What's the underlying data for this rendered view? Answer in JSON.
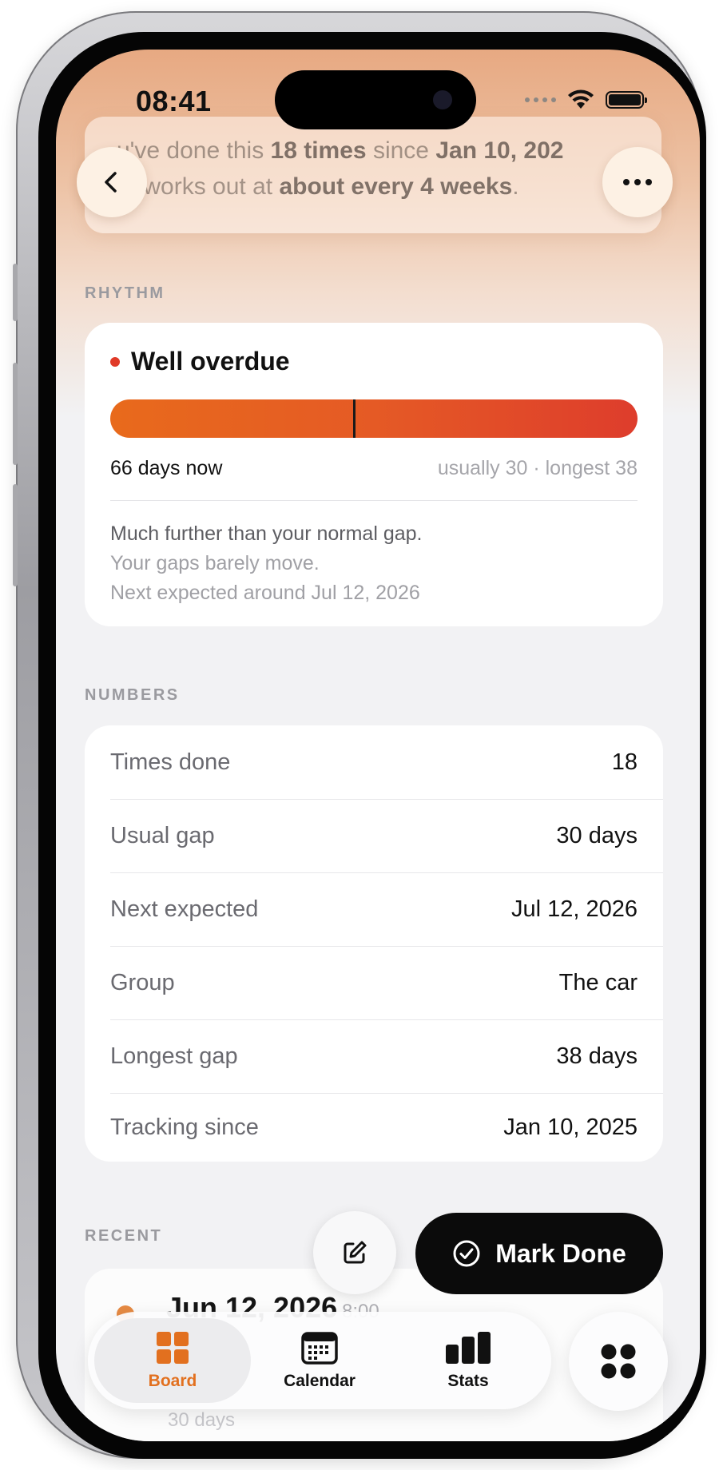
{
  "status_bar": {
    "time": "08:41"
  },
  "header": {
    "summary_line1_a": "u've done this ",
    "summary_line1_b": "18 times",
    "summary_line1_c": " since ",
    "summary_line1_d": "Jan 10, 202",
    "summary_line2_a": "at works out at ",
    "summary_line2_b": "about every 4 weeks",
    "summary_line2_c": "."
  },
  "rhythm": {
    "section_label": "RHYTHM",
    "status": "Well overdue",
    "progress_fraction": 0.46,
    "days_now": "66 days now",
    "usual_line": "usually 30 · longest 38",
    "note_primary": "Much further than your normal gap.",
    "note_secondary": "Your gaps barely move.",
    "note_next": "Next expected around Jul 12, 2026",
    "status_color": "#e03a28"
  },
  "numbers": {
    "section_label": "NUMBERS",
    "rows": [
      {
        "label": "Times done",
        "value": "18"
      },
      {
        "label": "Usual gap",
        "value": "30 days"
      },
      {
        "label": "Next expected",
        "value": "Jul 12, 2026"
      },
      {
        "label": "Group",
        "value": "The car"
      },
      {
        "label": "Longest gap",
        "value": "38 days"
      },
      {
        "label": "Tracking since",
        "value": "Jan 10, 2025"
      }
    ]
  },
  "recent": {
    "section_label": "RECENT",
    "items": [
      {
        "date": "Jun 12, 2026",
        "time": "8:00",
        "gap": "30 days"
      }
    ]
  },
  "actions": {
    "mark_done": "Mark Done"
  },
  "tabbar": {
    "tabs": [
      {
        "label": "Board",
        "icon": "grid-icon",
        "active": true
      },
      {
        "label": "Calendar",
        "icon": "calendar-icon",
        "active": false
      },
      {
        "label": "Stats",
        "icon": "bar-chart-icon",
        "active": false
      }
    ],
    "accent": "#e2701f"
  }
}
